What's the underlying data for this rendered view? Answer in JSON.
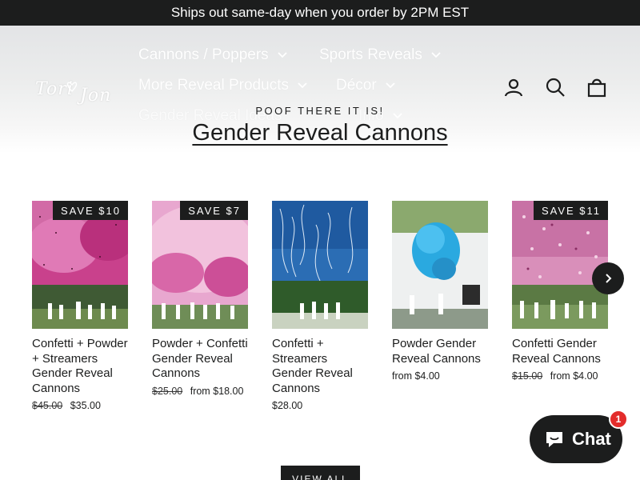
{
  "announcement": {
    "text": "Ships out same-day when you order by 2PM EST"
  },
  "brand": {
    "logo_text": "Tori Jon"
  },
  "nav": {
    "items": [
      {
        "label": "Cannons / Poppers"
      },
      {
        "label": "Sports Reveals"
      },
      {
        "label": "More Reveal Products"
      },
      {
        "label": "Décor"
      },
      {
        "label": "Gender Reveal Ideas"
      },
      {
        "label": "Info"
      }
    ],
    "icons": [
      "user-icon",
      "search-icon",
      "bag-icon"
    ]
  },
  "collection": {
    "kicker": "POOF THERE IT IS!",
    "title": "Gender Reveal Cannons"
  },
  "products": [
    {
      "badge": "SAVE $10",
      "name": "Confetti + Powder + Streamers Gender Reveal Cannons",
      "old_price": "$45.00",
      "price": "$35.00",
      "image": "pink-powder-confetti-crowd"
    },
    {
      "badge": "SAVE $7",
      "name": "Powder + Confetti Gender Reveal Cannons",
      "old_price": "$25.00",
      "price": "from $18.00",
      "image": "pink-powder-cloud-crowd"
    },
    {
      "badge": "",
      "name": "Confetti + Streamers Gender Reveal Cannons",
      "old_price": "",
      "price": "$28.00",
      "image": "blue-sky-streamers"
    },
    {
      "badge": "",
      "name": "Powder Gender Reveal Cannons",
      "old_price": "",
      "price": "from $4.00",
      "image": "blue-powder-burst-house"
    },
    {
      "badge": "SAVE $11",
      "name": "Confetti Gender Reveal Cannons",
      "old_price": "$15.00",
      "price": "from $4.00",
      "image": "pink-confetti-crowd"
    }
  ],
  "carousel": {
    "next_icon": "chevron-right-icon"
  },
  "view_all": {
    "label": "VIEW ALL"
  },
  "chat": {
    "label": "Chat",
    "unread": "1",
    "colors": {
      "bg": "#1c1d1d",
      "badge": "#e32c2b"
    }
  }
}
